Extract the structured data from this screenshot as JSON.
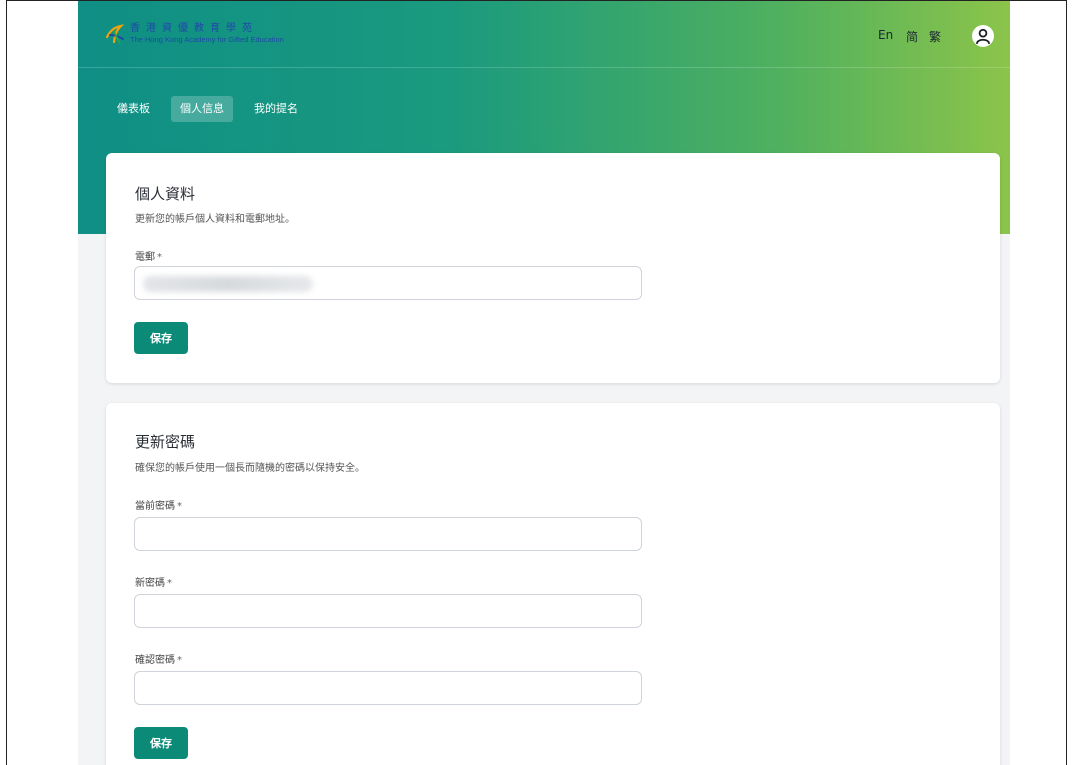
{
  "header": {
    "logo_cn": "香港資優教育學苑",
    "logo_en": "The Hong Kong Academy for Gifted Education",
    "lang_en": "En",
    "lang_sc": "简",
    "lang_tc": "繁"
  },
  "nav": {
    "tabs": [
      {
        "label": "儀表板"
      },
      {
        "label": "個人信息"
      },
      {
        "label": "我的提名"
      }
    ],
    "active": 1
  },
  "profile": {
    "title": "個人資料",
    "subtitle": "更新您的帳戶個人資料和電郵地址。",
    "email_label": "電郵",
    "email_value": "",
    "save_label": "保存"
  },
  "password": {
    "title": "更新密碼",
    "subtitle": "確保您的帳戶使用一個長而隨機的密碼以保持安全。",
    "current_label": "當前密碼",
    "new_label": "新密碼",
    "confirm_label": "確認密碼",
    "save_label": "保存"
  },
  "required_mark": "*",
  "colors": {
    "gradient_start": "#0f8f85",
    "gradient_end": "#8cc44a",
    "button": "#0b8a78",
    "logo": "#1f4aa8"
  },
  "icons": {
    "logo": "hkage-logo-icon",
    "avatar": "user-icon"
  }
}
